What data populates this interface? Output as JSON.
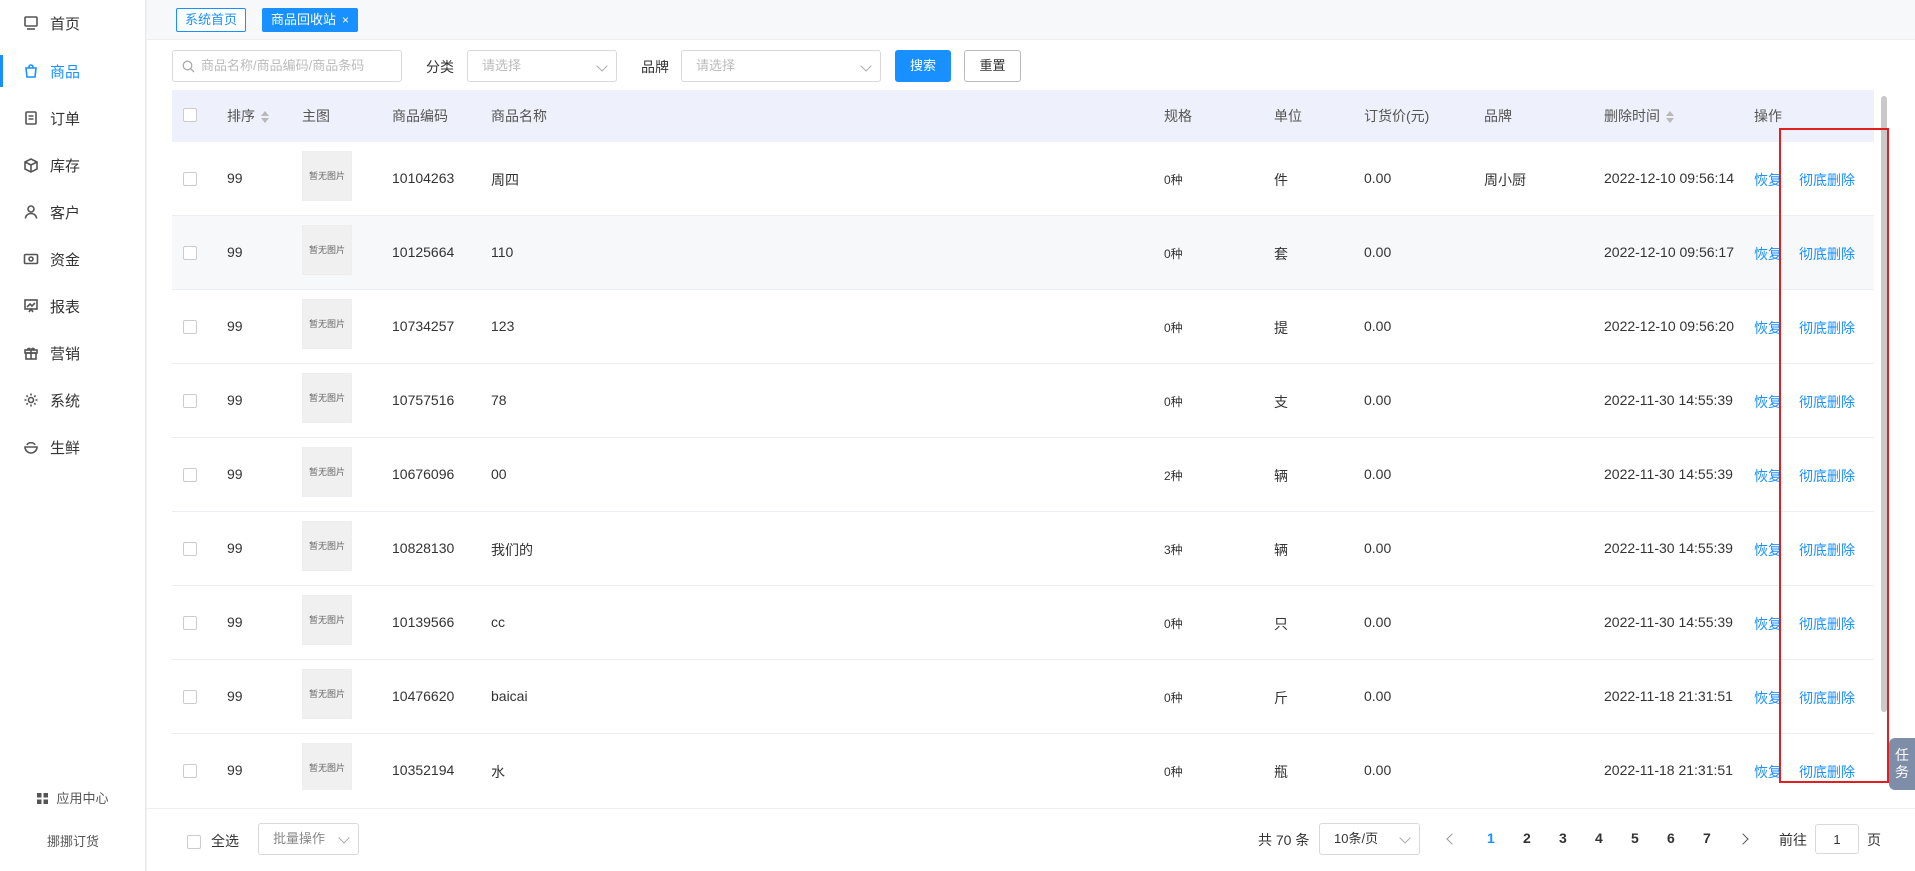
{
  "sidebar": {
    "items": [
      {
        "label": "首页",
        "icon": "home-icon",
        "active": false
      },
      {
        "label": "商品",
        "icon": "shopping-bag-icon",
        "active": true
      },
      {
        "label": "订单",
        "icon": "document-icon",
        "active": false
      },
      {
        "label": "库存",
        "icon": "box-icon",
        "active": false
      },
      {
        "label": "客户",
        "icon": "user-icon",
        "active": false
      },
      {
        "label": "资金",
        "icon": "money-icon",
        "active": false
      },
      {
        "label": "报表",
        "icon": "chart-board-icon",
        "active": false
      },
      {
        "label": "营销",
        "icon": "gift-icon",
        "active": false
      },
      {
        "label": "系统",
        "icon": "gear-icon",
        "active": false
      },
      {
        "label": "生鲜",
        "icon": "bowl-icon",
        "active": false
      }
    ],
    "app_center": "应用中心",
    "brand": "挪挪订货"
  },
  "tabs": [
    {
      "label": "系统首页",
      "active": false
    },
    {
      "label": "商品回收站",
      "active": true,
      "close": "×"
    }
  ],
  "filters": {
    "search_placeholder": "商品名称/商品编码/商品条码",
    "category_label": "分类",
    "category_placeholder": "请选择",
    "brand_label": "品牌",
    "brand_placeholder": "请选择",
    "search_button": "搜索",
    "reset_button": "重置"
  },
  "table": {
    "headers": {
      "sort": "排序",
      "image": "主图",
      "code": "商品编码",
      "name": "商品名称",
      "spec": "规格",
      "unit": "单位",
      "price": "订货价(元)",
      "brand": "品牌",
      "deleted_at": "删除时间",
      "actions": "操作"
    },
    "no_image_text": "暂无图片",
    "restore_label": "恢复",
    "delete_label": "彻底删除",
    "rows": [
      {
        "sort": "99",
        "code": "10104263",
        "name": "周四",
        "spec": "0种",
        "unit": "件",
        "price": "0.00",
        "brand": "周小厨",
        "deleted_at": "2022-12-10 09:56:14"
      },
      {
        "sort": "99",
        "code": "10125664",
        "name": "110",
        "spec": "0种",
        "unit": "套",
        "price": "0.00",
        "brand": "",
        "deleted_at": "2022-12-10 09:56:17"
      },
      {
        "sort": "99",
        "code": "10734257",
        "name": "123",
        "spec": "0种",
        "unit": "提",
        "price": "0.00",
        "brand": "",
        "deleted_at": "2022-12-10 09:56:20"
      },
      {
        "sort": "99",
        "code": "10757516",
        "name": "78",
        "spec": "0种",
        "unit": "支",
        "price": "0.00",
        "brand": "",
        "deleted_at": "2022-11-30 14:55:39"
      },
      {
        "sort": "99",
        "code": "10676096",
        "name": "00",
        "spec": "2种",
        "unit": "辆",
        "price": "0.00",
        "brand": "",
        "deleted_at": "2022-11-30 14:55:39"
      },
      {
        "sort": "99",
        "code": "10828130",
        "name": "我们的",
        "spec": "3种",
        "unit": "辆",
        "price": "0.00",
        "brand": "",
        "deleted_at": "2022-11-30 14:55:39"
      },
      {
        "sort": "99",
        "code": "10139566",
        "name": "cc",
        "spec": "0种",
        "unit": "只",
        "price": "0.00",
        "brand": "",
        "deleted_at": "2022-11-30 14:55:39"
      },
      {
        "sort": "99",
        "code": "10476620",
        "name": "baicai",
        "spec": "0种",
        "unit": "斤",
        "price": "0.00",
        "brand": "",
        "deleted_at": "2022-11-18 21:31:51"
      },
      {
        "sort": "99",
        "code": "10352194",
        "name": "水",
        "spec": "0种",
        "unit": "瓶",
        "price": "0.00",
        "brand": "",
        "deleted_at": "2022-11-18 21:31:51"
      }
    ]
  },
  "footer": {
    "select_all": "全选",
    "batch_placeholder": "批量操作",
    "total": "共 70 条",
    "page_size": "10条/页",
    "pages": [
      "1",
      "2",
      "3",
      "4",
      "5",
      "6",
      "7"
    ],
    "current_page": "1",
    "goto_prefix": "前往",
    "goto_value": "1",
    "goto_suffix": "页"
  },
  "task_button": "任务",
  "colors": {
    "accent": "#1890ff",
    "highlight": "#e02020",
    "header_bg": "#eef1fb"
  }
}
